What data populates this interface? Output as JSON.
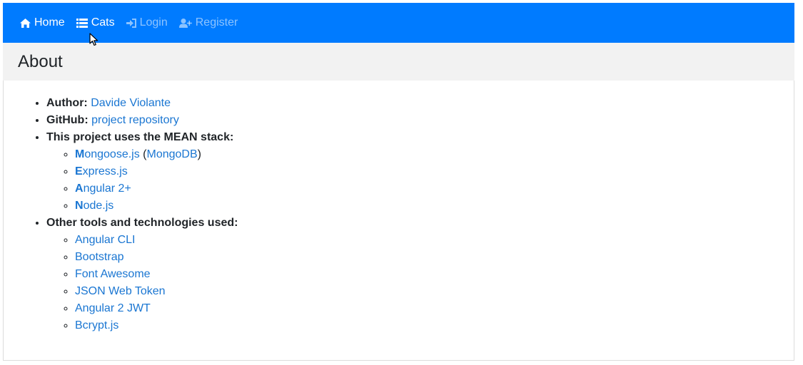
{
  "nav": {
    "home": {
      "label": "Home",
      "icon": "home-icon"
    },
    "cats": {
      "label": "Cats",
      "icon": "list-icon"
    },
    "login": {
      "label": "Login",
      "icon": "sign-in-icon"
    },
    "register": {
      "label": "Register",
      "icon": "user-plus-icon"
    },
    "colors": {
      "bar": "#007bff",
      "active": "#ffffff"
    }
  },
  "page": {
    "title": "About"
  },
  "about": {
    "author_label": "Author:",
    "author_name": "Davide Violante",
    "github_label": "GitHub:",
    "github_link": "project repository",
    "stack_label": "This project uses the MEAN stack:",
    "stack": [
      {
        "initial": "M",
        "rest": "ongoose.js",
        "extra_open": " (",
        "extra_link": "MongoDB",
        "extra_close": ")"
      },
      {
        "initial": "E",
        "rest": "xpress.js"
      },
      {
        "initial": "A",
        "rest": "ngular 2+"
      },
      {
        "initial": "N",
        "rest": "ode.js"
      }
    ],
    "tools_label": "Other tools and technologies used:",
    "tools": [
      "Angular CLI",
      "Bootstrap",
      "Font Awesome",
      "JSON Web Token",
      "Angular 2 JWT",
      "Bcrypt.js"
    ],
    "link_color": "#1a76d2"
  }
}
